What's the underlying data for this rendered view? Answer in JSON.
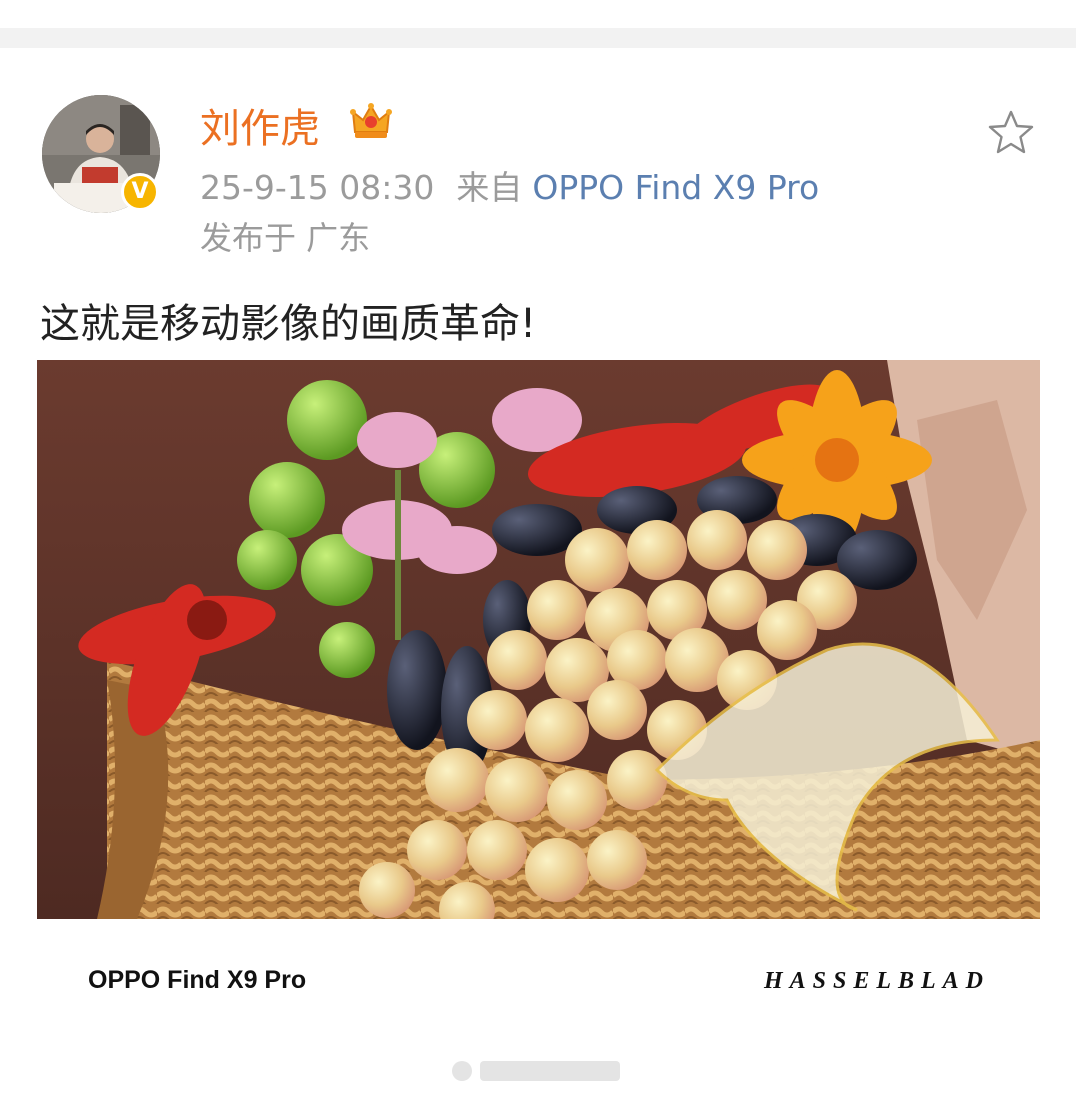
{
  "post": {
    "author": {
      "name": "刘作虎",
      "verified": true,
      "avatar_icon": "avatar-photo",
      "membership_icon": "crown-icon"
    },
    "timestamp": "25-9-15 08:30",
    "source_label": "来自",
    "source_device": "OPPO Find X9 Pro",
    "location": "发布于 广东",
    "text": "这就是移动影像的画质革命!",
    "favorite_icon": "star-icon",
    "image": {
      "description_icon": "photo-fruit-basket",
      "device_caption": "OPPO Find X9 Pro",
      "brand_caption": "HASSELBLAD"
    }
  },
  "colors": {
    "username": "#eb7022",
    "link": "#5b7fb0",
    "meta": "#9b9b9b",
    "verified_badge": "#f7b500",
    "text": "#222222"
  }
}
